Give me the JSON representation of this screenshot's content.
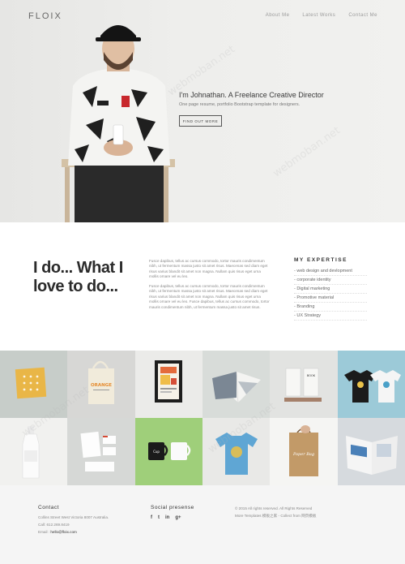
{
  "header": {
    "logo": "FLOIX",
    "nav": [
      "About Me",
      "Latest Works",
      "Contact Me"
    ]
  },
  "hero": {
    "title": "I'm Johnathan. A Freelance Creative Director",
    "subtitle": "One page resume, portfolio Bootstrap template for designers.",
    "button": "FIND OUT MORE"
  },
  "about": {
    "heading_line1": "I do... What I",
    "heading_line2": "love to do...",
    "paragraph1": "Fusce dapibus, tellus ac cursus commodo, tortor mauris condimentum nibh, ut fermentum massa justo sit amet risus. Maecenas sed diam eget risus varius blandit sit amet non magna. Nullam quis risus eget urna mollis ornare vel eu leo.",
    "paragraph2": "Fusce dapibus, tellus ac cursus commodo, tortor mauris condimentum nibh, ut fermentum massa justo sit amet risus. Maecenas sed diam eget risus varius blandit sit amet non magna. Nullam quis risus eget urna mollis ornare vel eu leo. Fusce dapibus, tellus ac cursus commodo, tortor mauris condimentum nibh, ut fermentum massa justo sit amet risus.",
    "expertise_title": "MY EXPERTISE",
    "expertise": [
      "- web design and devlopment",
      "- corporate identity",
      "- Digital marketing",
      "- Promotive material",
      "- Branding",
      "- UX Strategy"
    ]
  },
  "gallery": {
    "tote_text": "ORANGE",
    "cup_text": "Cup",
    "bag_text": "Paper Bag",
    "book_text": "BOOK"
  },
  "footer": {
    "contact_title": "Contact",
    "address": "Collins Street West Victoria 8007 Australia.",
    "call": "Call: 612.269.8419",
    "email_label": "Email : ",
    "email": "hello@floix.com",
    "social_title": "Social presense",
    "social": [
      "f",
      "t",
      "in",
      "g+"
    ],
    "copyright": "© 2015 All rights reserved. All Rights Reserved",
    "more": "More Templates 模板之家 - Collect from 网页模板"
  },
  "colors": {
    "accent": "#2b2b2b",
    "hero_bg": "#ebebe9",
    "footer_bg": "#f5f5f5"
  }
}
